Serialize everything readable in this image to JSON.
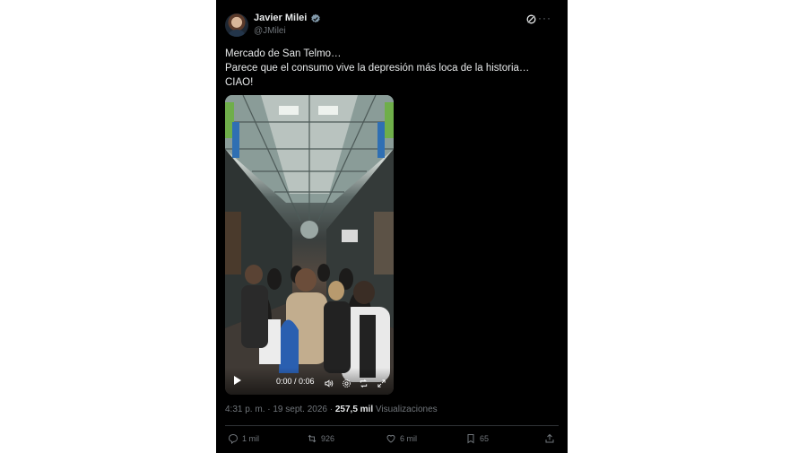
{
  "tweet": {
    "author": {
      "name": "Javier Milei",
      "handle": "@JMilei",
      "verified": true
    },
    "text_lines": [
      "Mercado de San Telmo…",
      "Parece que el consumo vive la depresión más loca de la historia…",
      "CIAO!"
    ],
    "video": {
      "time": "0:00 / 0:06"
    },
    "timestamp": "4:31 p. m. · 19 sept. 2026 · ",
    "views": {
      "count": "257,5 mil",
      "label": "Visualizaciones"
    },
    "actions": {
      "replies": "1 mil",
      "reposts": "926",
      "likes": "6 mil",
      "bookmarks": "65"
    }
  },
  "colors": {
    "background": "#000000",
    "text_primary": "#e7e9ea",
    "text_secondary": "#71767b",
    "verified_badge": "#829aab",
    "divider": "#2f3336"
  },
  "icons": [
    "verified-icon",
    "grok-icon",
    "more-icon",
    "play-icon",
    "volume-icon",
    "settings-icon",
    "loop-icon",
    "fullscreen-icon",
    "reply-icon",
    "repost-icon",
    "like-icon",
    "bookmark-icon",
    "share-icon"
  ]
}
